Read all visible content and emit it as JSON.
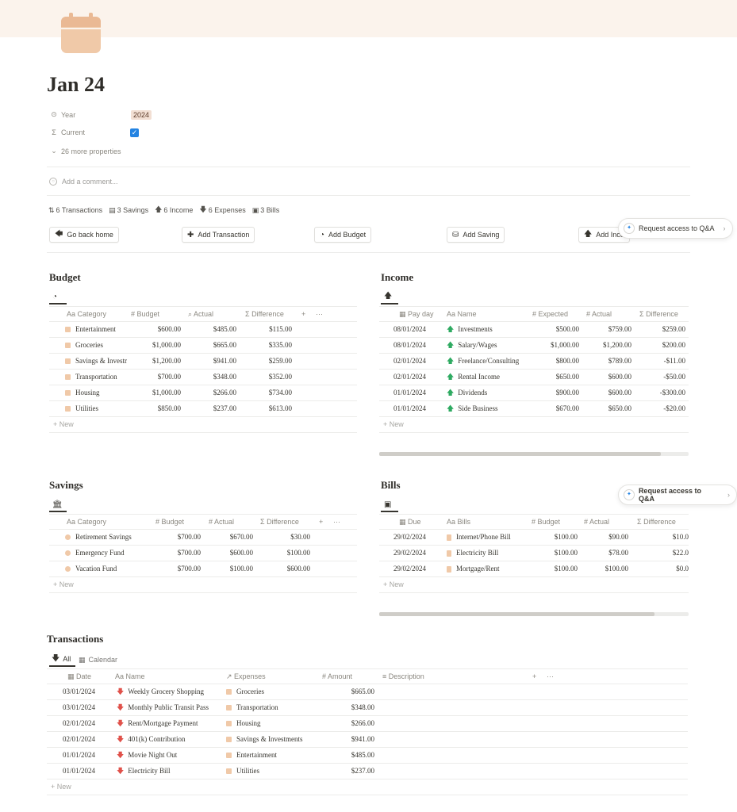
{
  "page": {
    "title": "Jan 24",
    "properties": {
      "year_label": "Year",
      "year_value": "2024",
      "current_label": "Current",
      "more_label": "26 more properties"
    },
    "comment_placeholder": "Add a comment...",
    "counts": [
      {
        "icon": "sort-icon",
        "glyph": "⇅",
        "label": "6 Transactions"
      },
      {
        "icon": "savings-icon",
        "glyph": "▤",
        "label": "3 Savings"
      },
      {
        "icon": "arrow-up-icon",
        "glyph": "🡅",
        "label": "6 Income"
      },
      {
        "icon": "arrow-down-icon",
        "glyph": "🡇",
        "label": "6 Expenses"
      },
      {
        "icon": "document-icon",
        "glyph": "▣",
        "label": "3 Bills"
      }
    ],
    "buttons": [
      {
        "label": "Go back home",
        "glyph": "🡄"
      },
      {
        "label": "Add Transaction",
        "glyph": "✚"
      },
      {
        "label": "Add Budget",
        "glyph": "◔"
      },
      {
        "label": "Add Saving",
        "glyph": "⛁"
      },
      {
        "label": "Add Inco",
        "glyph": "🡅"
      }
    ],
    "qa_label": "Request access to Q&A"
  },
  "budget": {
    "title": "Budget",
    "columns": [
      "Category",
      "Budget",
      "Actual",
      "Difference"
    ],
    "rows": [
      [
        "Entertainment",
        "$600.00",
        "$485.00",
        "$115.00"
      ],
      [
        "Groceries",
        "$1,000.00",
        "$665.00",
        "$335.00"
      ],
      [
        "Savings & Investm",
        "$1,200.00",
        "$941.00",
        "$259.00"
      ],
      [
        "Transportation",
        "$700.00",
        "$348.00",
        "$352.00"
      ],
      [
        "Housing",
        "$1,000.00",
        "$266.00",
        "$734.00"
      ],
      [
        "Utilities",
        "$850.00",
        "$237.00",
        "$613.00"
      ]
    ],
    "new_label": "New"
  },
  "income": {
    "title": "Income",
    "columns": [
      "Pay day",
      "Name",
      "Expected",
      "Actual",
      "Difference"
    ],
    "rows": [
      [
        "08/01/2024",
        "Investments",
        "$500.00",
        "$759.00",
        "$259.00"
      ],
      [
        "08/01/2024",
        "Salary/Wages",
        "$1,000.00",
        "$1,200.00",
        "$200.00"
      ],
      [
        "02/01/2024",
        "Freelance/Consulting",
        "$800.00",
        "$789.00",
        "-$11.00"
      ],
      [
        "02/01/2024",
        "Rental Income",
        "$650.00",
        "$600.00",
        "-$50.00"
      ],
      [
        "01/01/2024",
        "Dividends",
        "$900.00",
        "$600.00",
        "-$300.00"
      ],
      [
        "01/01/2024",
        "Side Business",
        "$670.00",
        "$650.00",
        "-$20.00"
      ]
    ],
    "new_label": "New",
    "scroll_fraction": 0.91
  },
  "savings": {
    "title": "Savings",
    "columns": [
      "Category",
      "Budget",
      "Actual",
      "Difference"
    ],
    "rows": [
      [
        "Retirement Savings",
        "$700.00",
        "$670.00",
        "$30.00"
      ],
      [
        "Emergency Fund",
        "$700.00",
        "$600.00",
        "$100.00"
      ],
      [
        "Vacation Fund",
        "$700.00",
        "$100.00",
        "$600.00"
      ]
    ],
    "new_label": "New"
  },
  "bills": {
    "title": "Bills",
    "columns": [
      "Due",
      "Bills",
      "Budget",
      "Actual",
      "Difference"
    ],
    "rows": [
      [
        "29/02/2024",
        "Internet/Phone Bill",
        "$100.00",
        "$90.00",
        "$10.0"
      ],
      [
        "29/02/2024",
        "Electricity Bill",
        "$100.00",
        "$78.00",
        "$22.0"
      ],
      [
        "29/02/2024",
        "Mortgage/Rent",
        "$100.00",
        "$100.00",
        "$0.0"
      ]
    ],
    "new_label": "New",
    "scroll_fraction": 0.89
  },
  "transactions": {
    "title": "Transactions",
    "views": [
      "All",
      "Calendar"
    ],
    "columns": [
      "Date",
      "Name",
      "Expenses",
      "Amount",
      "Description"
    ],
    "rows": [
      [
        "03/01/2024",
        "Weekly Grocery Shopping",
        "Groceries",
        "$665.00"
      ],
      [
        "03/01/2024",
        "Monthly Public Transit Pass",
        "Transportation",
        "$348.00"
      ],
      [
        "02/01/2024",
        "Rent/Mortgage Payment",
        "Housing",
        "$266.00"
      ],
      [
        "02/01/2024",
        "401(k) Contribution",
        "Savings & Investments",
        "$941.00"
      ],
      [
        "01/01/2024",
        "Movie Night Out",
        "Entertainment",
        "$485.00"
      ],
      [
        "01/01/2024",
        "Electricity Bill",
        "Utilities",
        "$237.00"
      ]
    ],
    "new_label": "New"
  },
  "colors": {
    "cover": "#fbf3ec",
    "accent_blue": "#2383e2",
    "income_up": "#2eaa61",
    "expense_down": "#e0514a",
    "tag_peach": "#f0c9a8"
  }
}
